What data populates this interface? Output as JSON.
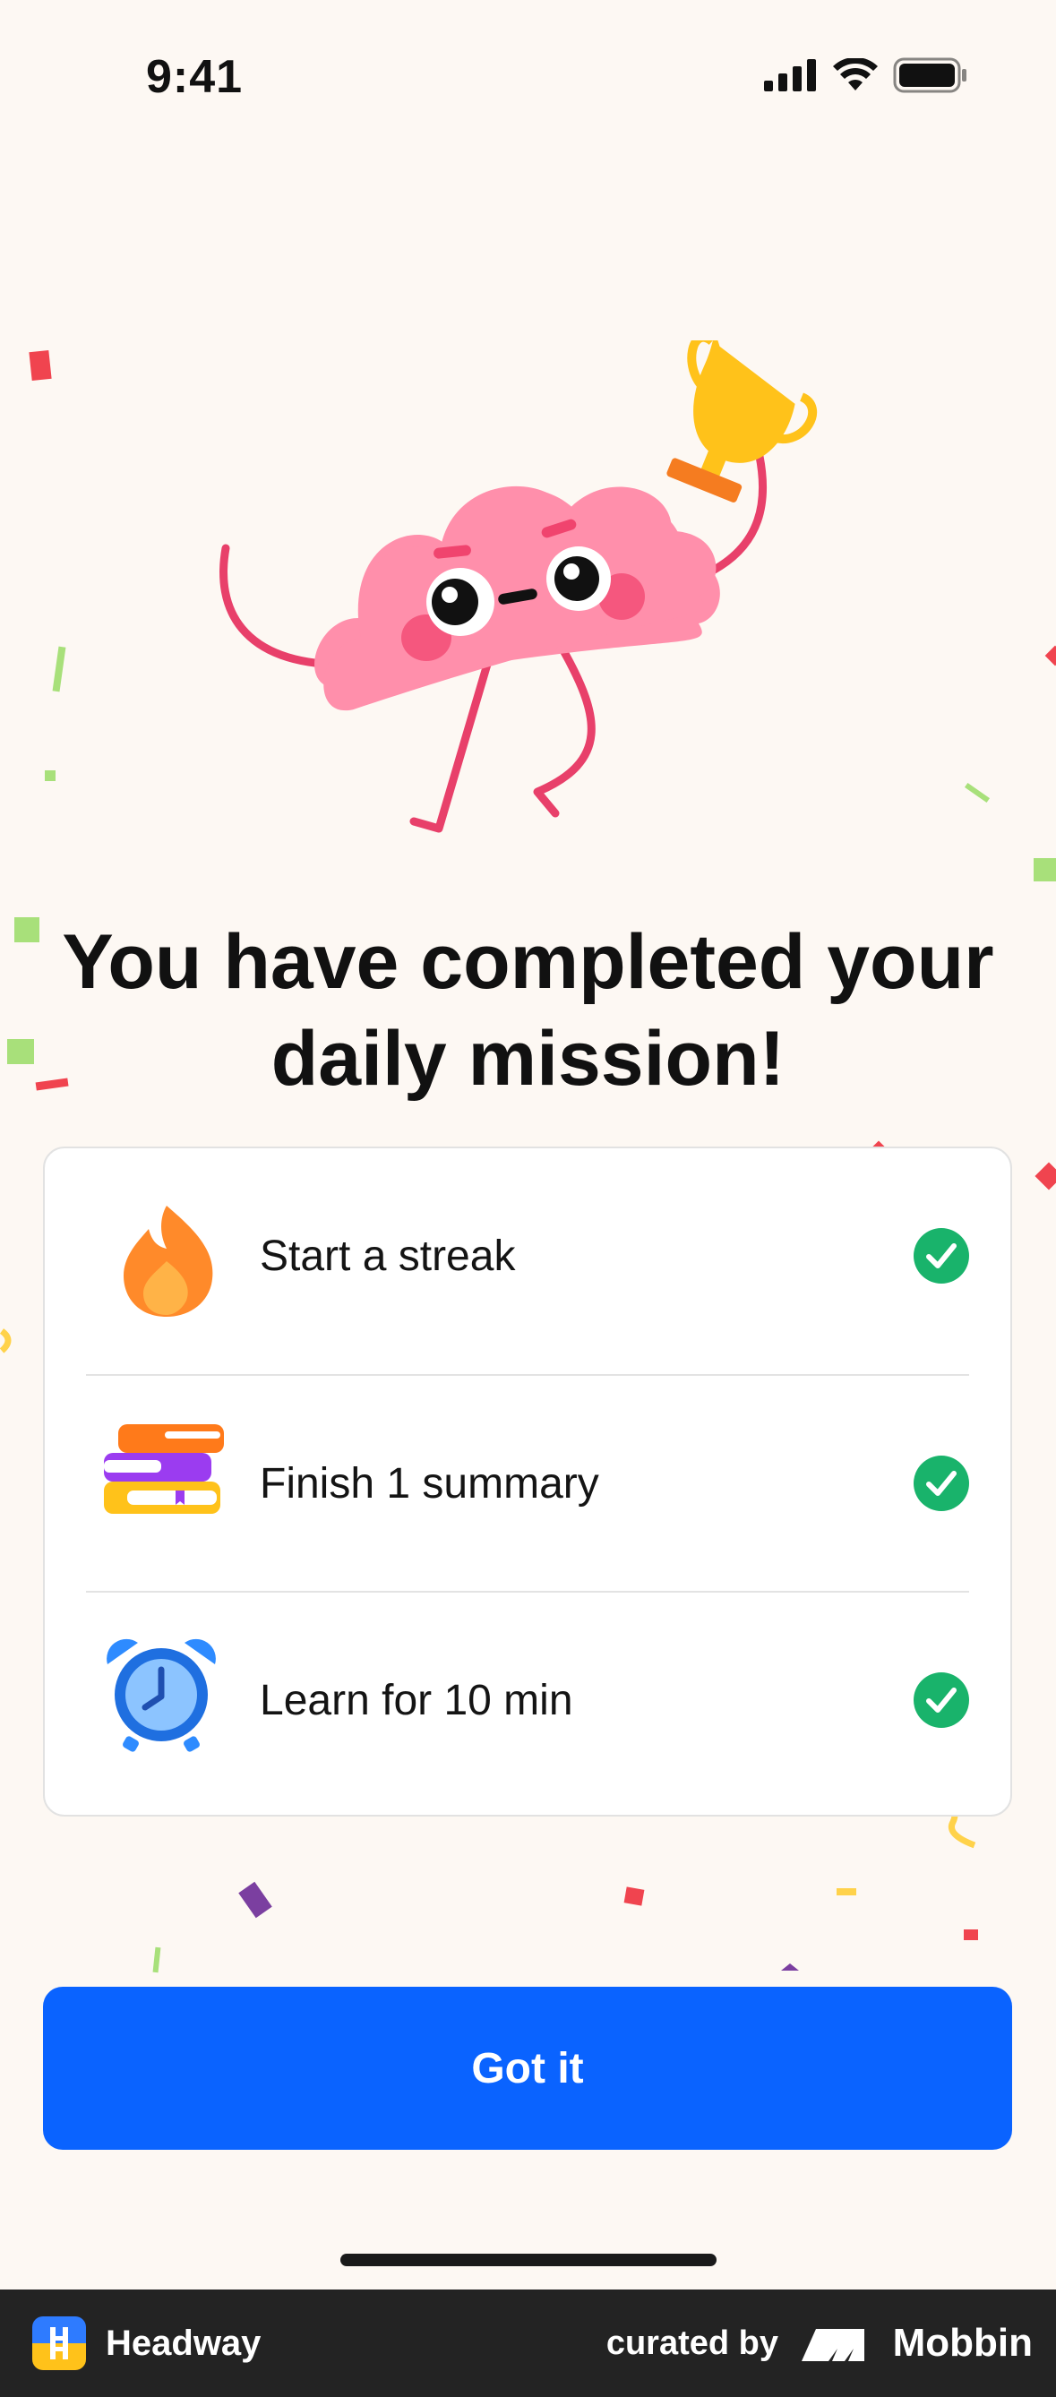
{
  "status_bar": {
    "time": "9:41"
  },
  "title": "You have completed your daily mission!",
  "tasks": [
    {
      "label": "Start a streak",
      "icon": "flame-icon",
      "done": true
    },
    {
      "label": "Finish 1 summary",
      "icon": "books-icon",
      "done": true
    },
    {
      "label": "Learn for 10 min",
      "icon": "alarm-clock-icon",
      "done": true
    }
  ],
  "button": {
    "label": "Got it"
  },
  "footer": {
    "app_name": "Headway",
    "curated_by": "curated by",
    "brand": "Mobbin"
  },
  "colors": {
    "background": "#FDF8F3",
    "accent": "#0A63FF",
    "check": "#19B36B",
    "brain": "#FF8FAB"
  }
}
